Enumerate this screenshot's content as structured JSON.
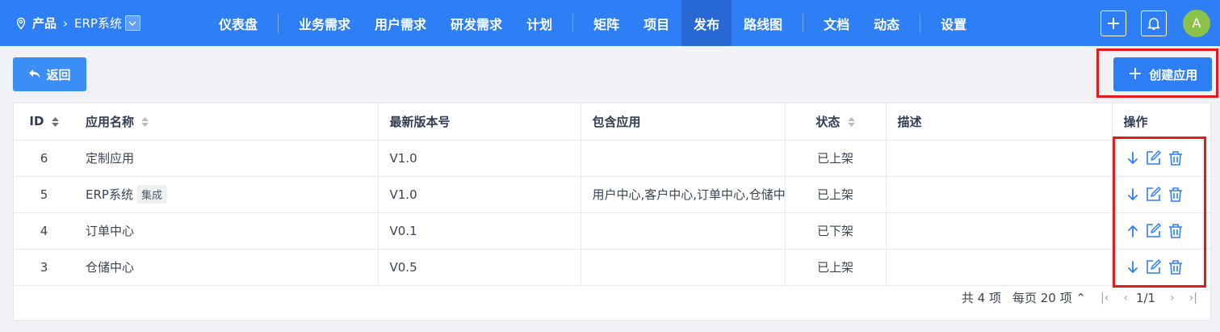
{
  "header": {
    "breadcrumb_root": "产品",
    "breadcrumb_product": "ERP系统",
    "nav": [
      {
        "label": "仪表盘"
      },
      {
        "label": "业务需求"
      },
      {
        "label": "用户需求"
      },
      {
        "label": "研发需求"
      },
      {
        "label": "计划"
      },
      {
        "label": "矩阵"
      },
      {
        "label": "项目"
      },
      {
        "label": "发布"
      },
      {
        "label": "路线图"
      },
      {
        "label": "文档"
      },
      {
        "label": "动态"
      },
      {
        "label": "设置"
      }
    ],
    "active_nav": "发布",
    "avatar_initial": "A"
  },
  "toolbar": {
    "back_label": "返回",
    "create_label": "创建应用"
  },
  "table": {
    "columns": {
      "id": "ID",
      "name": "应用名称",
      "version": "最新版本号",
      "apps": "包含应用",
      "status": "状态",
      "desc": "描述",
      "ops": "操作"
    },
    "rows": [
      {
        "id": "6",
        "name": "定制应用",
        "tag": "",
        "version": "V1.0",
        "apps": "",
        "status": "已上架",
        "desc": "",
        "publish_icon": "arrow-down-icon"
      },
      {
        "id": "5",
        "name": "ERP系统",
        "tag": "集成",
        "version": "V1.0",
        "apps": "用户中心,客户中心,订单中心,仓储中心",
        "status": "已上架",
        "desc": "",
        "publish_icon": "arrow-down-icon"
      },
      {
        "id": "4",
        "name": "订单中心",
        "tag": "",
        "version": "V0.1",
        "apps": "",
        "status": "已下架",
        "desc": "",
        "publish_icon": "arrow-up-icon"
      },
      {
        "id": "3",
        "name": "仓储中心",
        "tag": "",
        "version": "V0.5",
        "apps": "",
        "status": "已上架",
        "desc": "",
        "publish_icon": "arrow-down-icon"
      }
    ]
  },
  "pagination": {
    "total": "共 4 项",
    "per_page": "每页 20 项",
    "page": "1/1"
  },
  "colors": {
    "primary": "#2e7ff5",
    "highlight": "#e8191a"
  }
}
